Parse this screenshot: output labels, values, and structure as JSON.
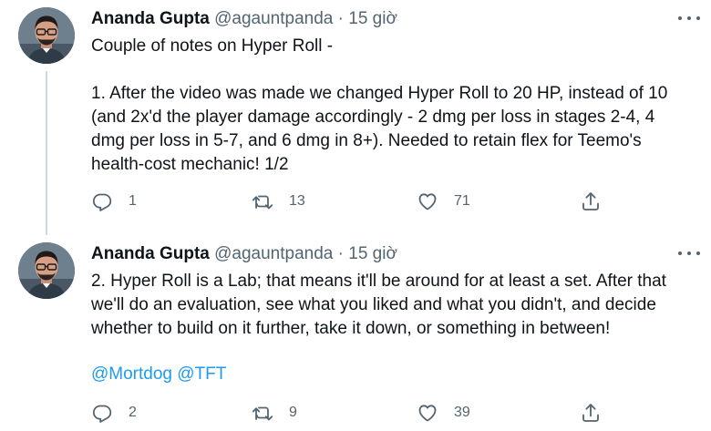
{
  "tweets": [
    {
      "author_name": "Ananda Gupta",
      "author_handle": "@agauntpanda",
      "separator": "·",
      "time": "15 giờ",
      "text": "Couple of notes on Hyper Roll -\n\n1. After the video was made we changed Hyper Roll to 20 HP, instead of 10\n(and 2x'd the player damage accordingly - 2 dmg per loss in stages 2-4, 4\ndmg per loss in 5-7, and 6 dmg in 8+). Needed to retain flex for Teemo's\nhealth-cost mechanic! 1/2",
      "replies": "1",
      "retweets": "13",
      "likes": "71"
    },
    {
      "author_name": "Ananda Gupta",
      "author_handle": "@agauntpanda",
      "separator": "·",
      "time": "15 giờ",
      "text": "2. Hyper Roll is a Lab; that means it'll be around for at least a set. After that\nwe'll do an evaluation, see what you liked and what you didn't, and decide\nwhether to build on it further, take it down, or something in between!",
      "mentions": [
        "@Mortdog",
        "@TFT"
      ],
      "replies": "2",
      "retweets": "9",
      "likes": "39"
    }
  ],
  "icons": {
    "reply": "reply-icon",
    "retweet": "retweet-icon",
    "like": "heart-icon",
    "share": "share-icon",
    "more": "more-icon"
  },
  "colors": {
    "text": "#0f1419",
    "secondary": "#536471",
    "link": "#1d9bf0",
    "thread_line": "#cfd9de"
  }
}
